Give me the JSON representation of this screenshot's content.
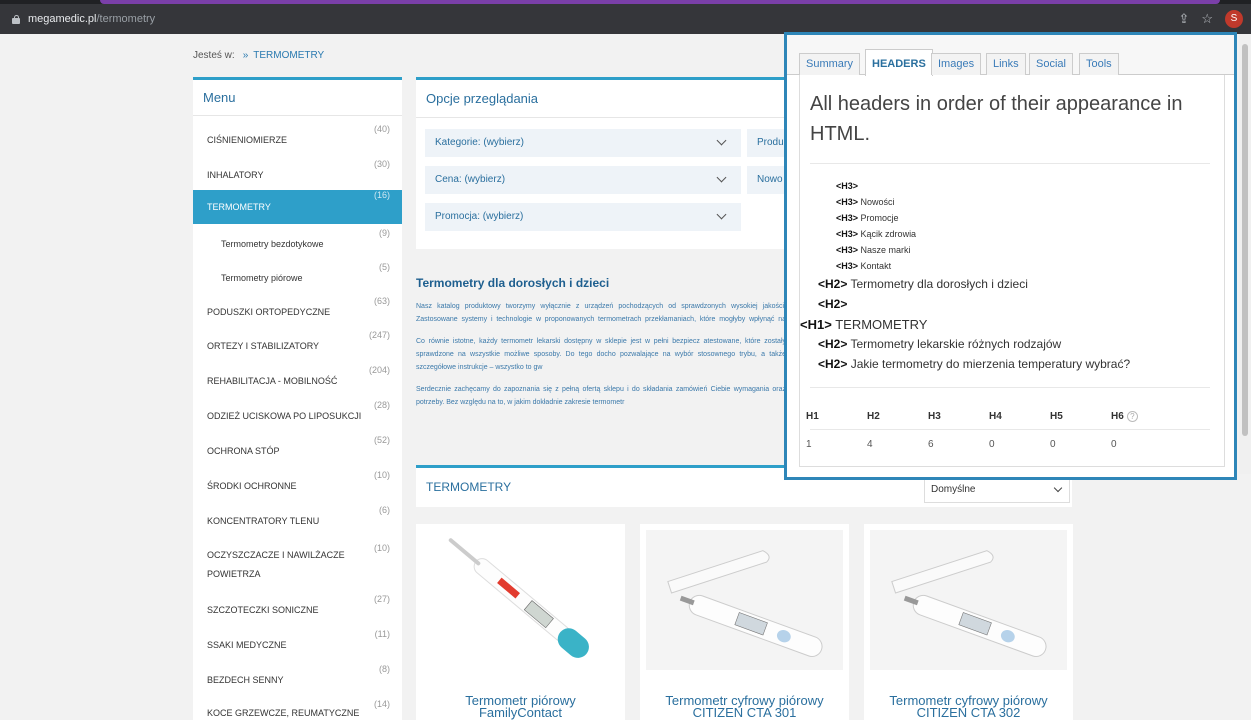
{
  "browser": {
    "url_host": "megamedic.pl",
    "url_path": "/termometry"
  },
  "breadcrumb": {
    "label": "Jesteś w:",
    "separator": "»",
    "current": "TERMOMETRY"
  },
  "menu": {
    "title": "Menu",
    "items": [
      {
        "label": "CIŚNIENIOMIERZE",
        "count": "(40)"
      },
      {
        "label": "INHALATORY",
        "count": "(30)"
      },
      {
        "label": "TERMOMETRY",
        "count": "(16)"
      },
      {
        "label": "Termometry bezdotykowe",
        "count": "(9)"
      },
      {
        "label": "Termometry piórowe",
        "count": "(5)"
      },
      {
        "label": "PODUSZKI ORTOPEDYCZNE",
        "count": "(63)"
      },
      {
        "label": "ORTEZY I STABILIZATORY",
        "count": "(247)"
      },
      {
        "label": "REHABILITACJA - MOBILNOŚĆ",
        "count": "(204)"
      },
      {
        "label": "ODZIEŻ UCISKOWA PO LIPOSUKCJI",
        "count": "(28)"
      },
      {
        "label": "OCHRONA STÓP",
        "count": "(52)"
      },
      {
        "label": "ŚRODKI OCHRONNE",
        "count": "(10)"
      },
      {
        "label": "KONCENTRATORY TLENU",
        "count": "(6)"
      },
      {
        "label": "OCZYSZCZACZE I NAWILŻACZE POWIETRZA",
        "count": "(10)"
      },
      {
        "label": "SZCZOTECZKI SONICZNE",
        "count": "(27)"
      },
      {
        "label": "SSAKI MEDYCZNE",
        "count": "(11)"
      },
      {
        "label": "BEZDECH SENNY",
        "count": "(8)"
      },
      {
        "label": "KOCE GRZEWCZE, REUMATYCZNE",
        "count": "(14)"
      }
    ]
  },
  "options": {
    "title": "Opcje przeglądania",
    "filters": {
      "kategorie": "Kategorie: (wybierz)",
      "producent": "Produ",
      "cena": "Cena: (wybierz)",
      "nowosc": "Nowo",
      "promocja": "Promocja: (wybierz)"
    }
  },
  "article": {
    "title": "Termometry dla dorosłych i dzieci",
    "p1": "Nasz katalog produktowy tworzymy wyłącznie z urządzeń pochodzących od sprawdzonych wysokiej jakości. Zastosowane systemy i technologie w proponowanych termometrach przekłamaniach, które mogłyby wpłynąć na niewłaściwą ocenę stanu zdrowia.",
    "p2": "Co równie istotne, każdy termometr lekarski dostępny w sklepie jest w pełni bezpiecz atestowane, które zostały sprawdzone na wszystkie możliwe sposoby. Do tego docho pozwalające na wybór stosownego trybu, a także szczegółowe instrukcje – wszystko to gw",
    "p3": "Serdecznie zachęcamy do zapoznania się z pełną ofertą sklepu i do składania zamówień Ciebie wymagania oraz potrzeby. Bez względu na to, w jakim dokładnie zakresie termometr"
  },
  "products": {
    "title": "TERMOMETRY",
    "sort_value": "Domyślne",
    "items": [
      {
        "name_line1": "Termometr piórowy",
        "name_line2": "FamilyContact"
      },
      {
        "name_line1": "Termometr cyfrowy piórowy",
        "name_line2": "CITIZEN CTA 301"
      },
      {
        "name_line1": "Termometr cyfrowy piórowy",
        "name_line2": "CITIZEN CTA 302"
      }
    ]
  },
  "extension": {
    "tabs": [
      "Summary",
      "HEADERS",
      "Images",
      "Links",
      "Social",
      "Tools"
    ],
    "active_tab": "HEADERS",
    "heading": "All headers in order of their appearance in HTML.",
    "headers": [
      {
        "tag": "<H3>",
        "text": ""
      },
      {
        "tag": "<H3>",
        "text": "Nowości"
      },
      {
        "tag": "<H3>",
        "text": "Promocje"
      },
      {
        "tag": "<H3>",
        "text": "Kącik zdrowia"
      },
      {
        "tag": "<H3>",
        "text": "Nasze marki"
      },
      {
        "tag": "<H3>",
        "text": "Kontakt"
      },
      {
        "tag": "<H2>",
        "text": "Termometry dla dorosłych i dzieci"
      },
      {
        "tag": "<H2>",
        "text": ""
      },
      {
        "tag": "<H1>",
        "text": "TERMOMETRY"
      },
      {
        "tag": "<H2>",
        "text": "Termometry lekarskie różnych rodzajów"
      },
      {
        "tag": "<H2>",
        "text": "Jakie termometry do mierzenia temperatury wybrać?"
      }
    ],
    "count_labels": [
      "H1",
      "H2",
      "H3",
      "H4",
      "H5",
      "H6"
    ],
    "count_values": [
      "1",
      "4",
      "6",
      "0",
      "0",
      "0"
    ],
    "help_icon": "?"
  }
}
